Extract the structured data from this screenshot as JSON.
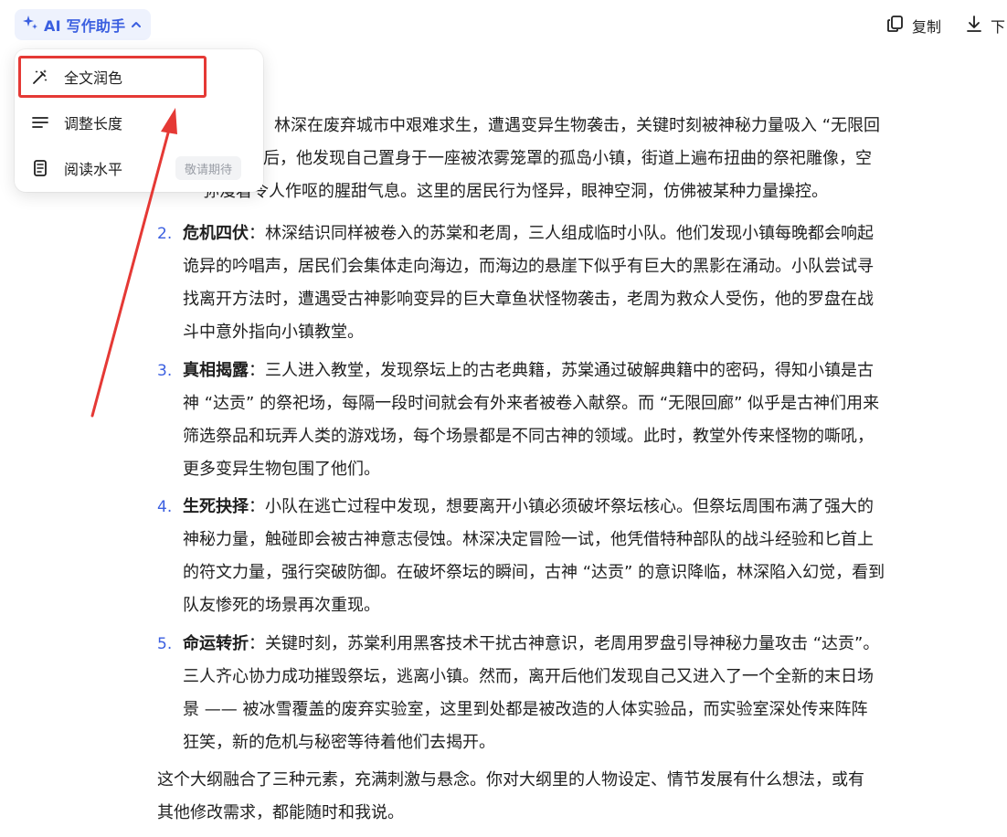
{
  "header": {
    "ai_button_label": "AI 写作助手",
    "copy_label": "复制",
    "download_label": "下"
  },
  "menu": {
    "items": [
      {
        "label": "全文润色",
        "icon": "wand-icon"
      },
      {
        "label": "调整长度",
        "icon": "lines-icon"
      },
      {
        "label": "阅读水平",
        "icon": "book-icon",
        "badge": "敬请期待"
      }
    ]
  },
  "content": {
    "items": [
      {
        "number": "",
        "title": "",
        "lines": [
          "林深在废弃城市中艰难求生，遭遇变异生物袭击，关键时刻被神秘力量吸入 “无限回",
          "后，他发现自己置身于一座被浓雾笼罩的孤岛小镇，街道上遍布扭曲的祭祀雕像，空",
          "弥漫着令人作呕的腥甜气息。这里的居民行为怪异，眼神空洞，仿佛被某种力量操控。"
        ]
      },
      {
        "number": "2.",
        "title": "危机四伏",
        "sep": "：",
        "lines": [
          "林深结识同样被卷入的苏棠和老周，三人组成临时小队。他们发现小镇每晚都会响起",
          "诡异的吟唱声，居民们会集体走向海边，而海边的悬崖下似乎有巨大的黑影在涌动。小队尝试寻",
          "找离开方法时，遭遇受古神影响变异的巨大章鱼状怪物袭击，老周为救众人受伤，他的罗盘在战",
          "斗中意外指向小镇教堂。"
        ]
      },
      {
        "number": "3.",
        "title": "真相揭露",
        "sep": "：",
        "lines": [
          "三人进入教堂，发现祭坛上的古老典籍，苏棠通过破解典籍中的密码，得知小镇是古",
          "神 “达贡” 的祭祀场，每隔一段时间就会有外来者被卷入献祭。而 “无限回廊” 似乎是古神们用来",
          "筛选祭品和玩弄人类的游戏场，每个场景都是不同古神的领域。此时，教堂外传来怪物的嘶吼，",
          "更多变异生物包围了他们。"
        ]
      },
      {
        "number": "4.",
        "title": "生死抉择",
        "sep": "：",
        "lines": [
          "小队在逃亡过程中发现，想要离开小镇必须破坏祭坛核心。但祭坛周围布满了强大的",
          "神秘力量，触碰即会被古神意志侵蚀。林深决定冒险一试，他凭借特种部队的战斗经验和匕首上",
          "的符文力量，强行突破防御。在破坏祭坛的瞬间，古神 “达贡” 的意识降临，林深陷入幻觉，看到",
          "队友惨死的场景再次重现。"
        ]
      },
      {
        "number": "5.",
        "title": "命运转折",
        "sep": "：",
        "lines": [
          "关键时刻，苏棠利用黑客技术干扰古神意识，老周用罗盘引导神秘力量攻击 “达贡”。",
          "三人齐心协力成功摧毁祭坛，逃离小镇。然而，离开后他们发现自己又进入了一个全新的末日场",
          "景 —— 被冰雪覆盖的废弃实验室，这里到处都是被改造的人体实验品，而实验室深处传来阵阵",
          "狂笑，新的危机与秘密等待着他们去揭开。"
        ]
      }
    ],
    "summary_lines": [
      "这个大纲融合了三种元素，充满刺激与悬念。你对大纲里的人物设定、情节发展有什么想法，或有",
      "其他修改需求，都能随时和我说。"
    ]
  },
  "colors": {
    "accent": "#3b5fe0",
    "highlight": "#e53935"
  }
}
